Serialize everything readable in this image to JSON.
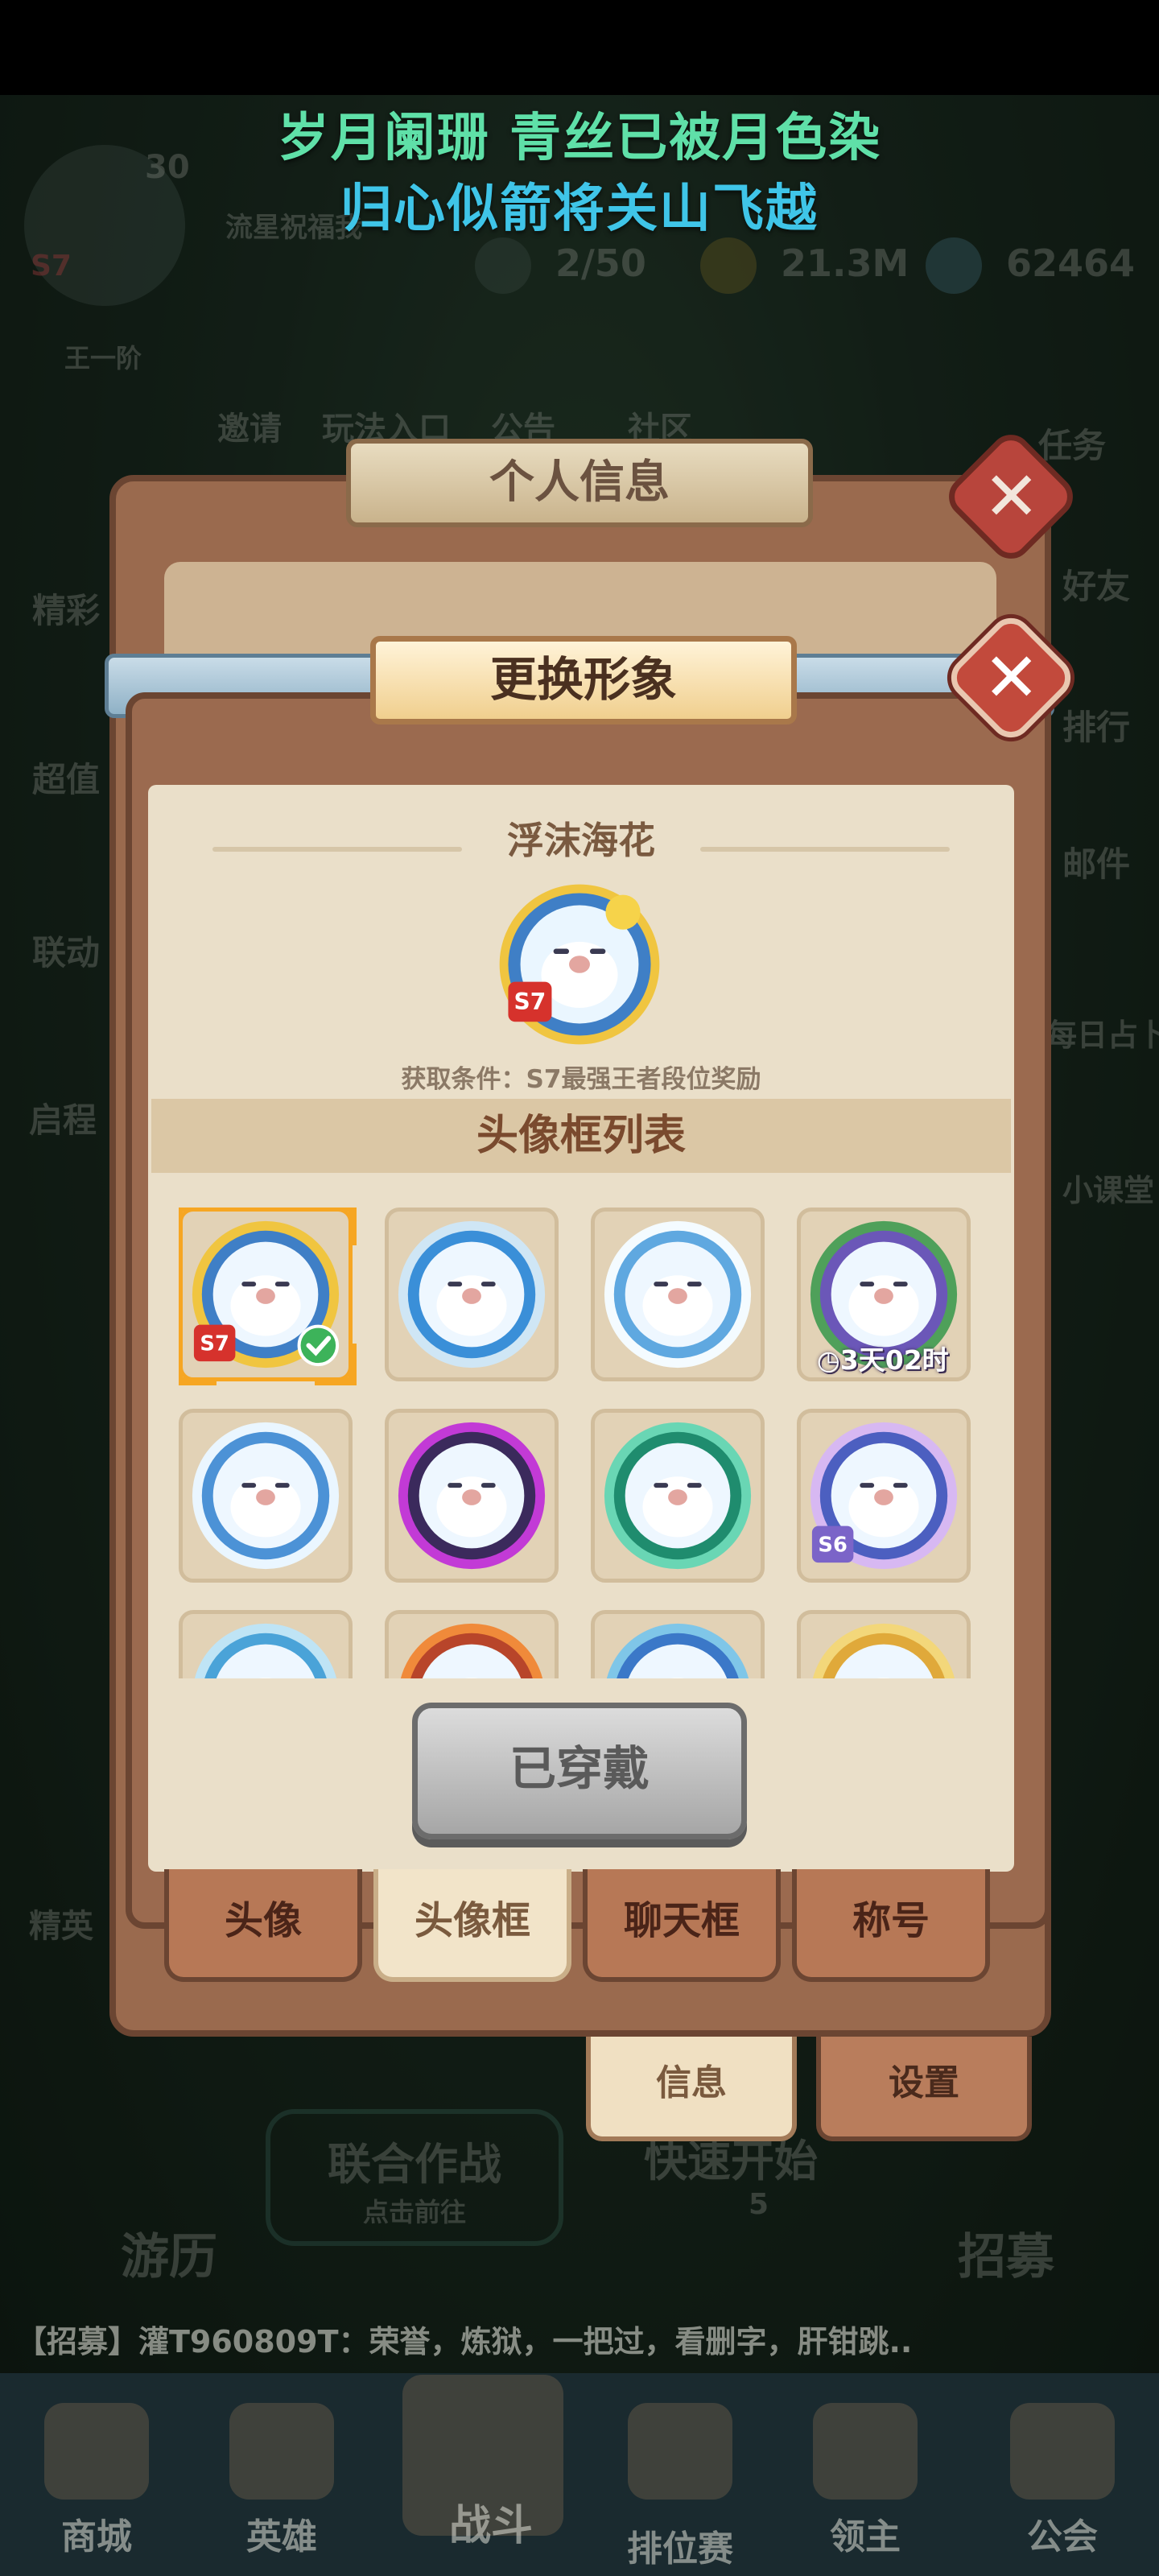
{
  "lyric": {
    "line1": "岁月阑珊 青丝已被月色染",
    "line2": "归心似箭将关山飞越"
  },
  "background": {
    "player_level": "30",
    "season_badge": "S7",
    "player_name": "流星祝福我",
    "rank_label": "王一阶",
    "energy": "2/50",
    "gold": "21.3M",
    "gems": "62464",
    "left_menu": [
      "精彩",
      "超值",
      "联动",
      "启程",
      "精英"
    ],
    "right_menu": [
      "任务",
      "好友",
      "排行",
      "邮件",
      "每日占卜",
      "小课堂"
    ],
    "top_shortcuts": [
      "邀请",
      "玩法入口",
      "公告",
      "社区"
    ],
    "coop_button": {
      "title": "联合作战",
      "subtitle": "点击前往"
    },
    "quick_start": {
      "title": "快速开始",
      "count": "5"
    },
    "travel_label": "游历",
    "recruit_label": "招募"
  },
  "back_panel": {
    "title": "个人信息",
    "tabs": [
      "信息",
      "设置"
    ]
  },
  "dialog": {
    "title": "更换形象",
    "preview": {
      "name": "浮沫海花",
      "badge": "S7",
      "condition": "获取条件：S7最强王者段位奖励"
    },
    "list_title": "头像框列表",
    "frames": [
      {
        "ring": "#3f7fc6",
        "accent": "#f0c540",
        "badge": "S7",
        "selected": true,
        "equipped": true
      },
      {
        "ring": "#3a8fd8",
        "accent": "#cfe6f5"
      },
      {
        "ring": "#5fa8e0",
        "accent": "#f4fbff"
      },
      {
        "ring": "#6b57b8",
        "accent": "#4fa05a",
        "timer": "3天02时"
      },
      {
        "ring": "#4c92d6",
        "accent": "#eaf6ff"
      },
      {
        "ring": "#3b2a5c",
        "accent": "#c23ad6"
      },
      {
        "ring": "#1f8c6e",
        "accent": "#69d6b4"
      },
      {
        "ring": "#4c5fc0",
        "accent": "#d7b8f2",
        "badge": "S6"
      },
      {
        "ring": "#4aa3d8",
        "accent": "#bfe4f5"
      },
      {
        "ring": "#b8452a",
        "accent": "#f08a3a"
      },
      {
        "ring": "#3b78c8",
        "accent": "#7fc6e8"
      },
      {
        "ring": "#e0a93a",
        "accent": "#f3d77a"
      }
    ],
    "wear_button": "已穿戴",
    "tabs": [
      "头像",
      "头像框",
      "聊天框",
      "称号"
    ],
    "active_tab": "头像框",
    "close_icon": "✕"
  },
  "chat": "【招募】灌T960809T：荣誉，炼狱，一把过，看删字，肝钳跳..",
  "bottom_nav": [
    "商城",
    "英雄",
    "战斗",
    "排位赛",
    "领主",
    "公会"
  ]
}
